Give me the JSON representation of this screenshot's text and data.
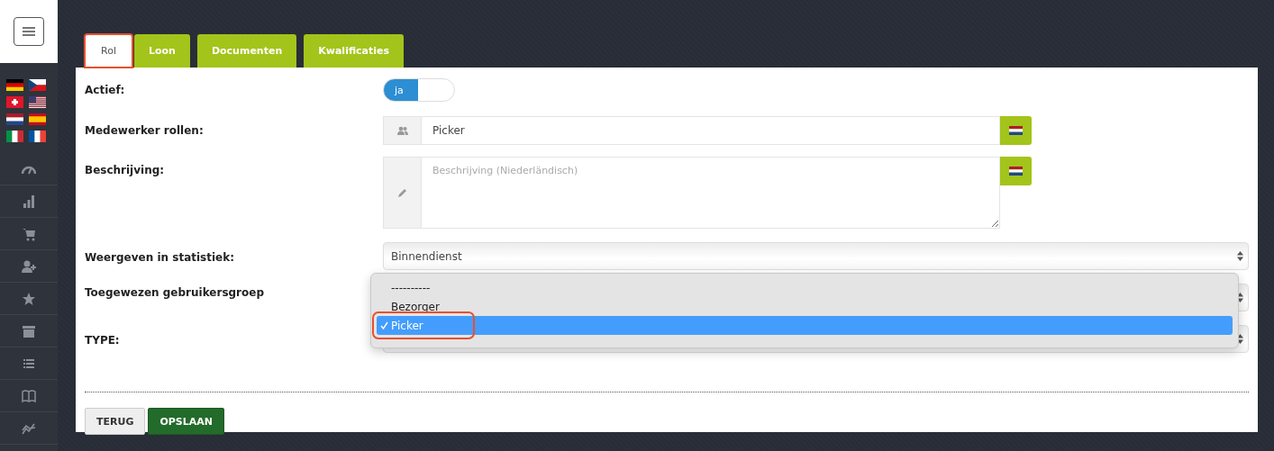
{
  "tabs": [
    {
      "label": "Rol",
      "selected": true,
      "highlighted": true
    },
    {
      "label": "Loon",
      "selected": false,
      "highlighted": false
    },
    {
      "label": "Documenten",
      "selected": false,
      "highlighted": false
    },
    {
      "label": "Kwalificaties",
      "selected": false,
      "highlighted": false
    }
  ],
  "form": {
    "active": {
      "label": "Actief:",
      "toggle_label": "ja",
      "on": true
    },
    "role": {
      "label": "Medewerker rollen:",
      "value": "Picker"
    },
    "description": {
      "label": "Beschrijving:",
      "placeholder": "Beschrijving (Niederländisch)"
    },
    "statistics": {
      "label": "Weergeven in statistiek:",
      "value": "Binnendienst"
    },
    "user_group": {
      "label": "Toegewezen gebruikersgroep"
    },
    "type": {
      "label": "TYPE:"
    }
  },
  "dropdown": {
    "options": [
      {
        "label": "----------",
        "selected": false,
        "highlighted": false
      },
      {
        "label": "Bezorger",
        "selected": false,
        "highlighted": false
      },
      {
        "label": "Picker",
        "selected": true,
        "highlighted": true
      }
    ]
  },
  "buttons": [
    {
      "label": "TERUG",
      "kind": "secondary"
    },
    {
      "label": "OPSLAAN",
      "kind": "primary"
    }
  ]
}
